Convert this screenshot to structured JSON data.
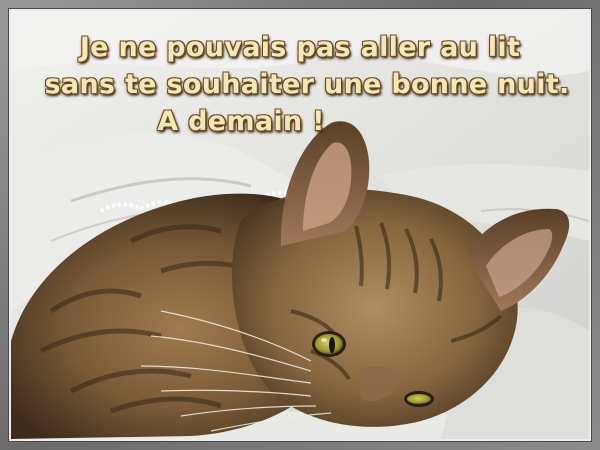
{
  "caption": {
    "line1": "Je ne pouvais pas aller au lit",
    "line2": "sans te souhaiter une bonne nuit.",
    "line3": "A demain !"
  },
  "colors": {
    "text": "#f6e7b8",
    "text_outline": "#6b4a22",
    "frame": "#7d7d7d",
    "blanket": "#e8e8e5",
    "cat_fur": "#8a6a45",
    "cat_eye": "#a9a436"
  },
  "scene": {
    "subject": "tabby-cat",
    "setting": "white-blanket"
  }
}
